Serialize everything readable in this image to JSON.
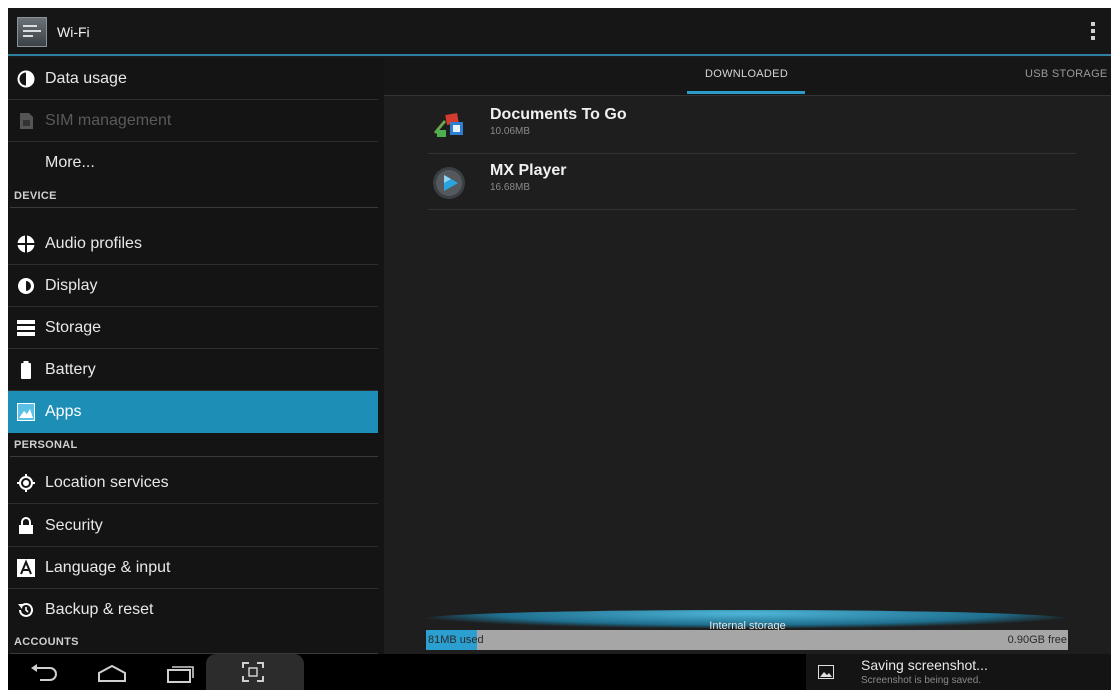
{
  "action_bar": {
    "title": "Wi-Fi",
    "app_icon": "settings-app-icon",
    "overflow_icon": "overflow-menu-icon"
  },
  "sidebar": {
    "rows": [
      {
        "label": "Data usage",
        "icon": "data-usage-icon",
        "state": "normal"
      },
      {
        "label": "SIM management",
        "icon": "sim-icon",
        "state": "disabled"
      },
      {
        "label": "More...",
        "icon": "",
        "state": "normal"
      }
    ],
    "device_header": "DEVICE",
    "device_rows": [
      {
        "label": "Audio profiles",
        "icon": "audio-profiles-icon"
      },
      {
        "label": "Display",
        "icon": "display-icon"
      },
      {
        "label": "Storage",
        "icon": "storage-icon"
      },
      {
        "label": "Battery",
        "icon": "battery-icon"
      },
      {
        "label": "Apps",
        "icon": "apps-icon",
        "selected": true
      }
    ],
    "personal_header": "PERSONAL",
    "personal_rows": [
      {
        "label": "Location services",
        "icon": "location-icon"
      },
      {
        "label": "Security",
        "icon": "lock-icon"
      },
      {
        "label": "Language & input",
        "icon": "keyboard-a-icon"
      },
      {
        "label": "Backup & reset",
        "icon": "backup-reset-icon"
      }
    ],
    "accounts_header": "ACCOUNTS"
  },
  "tabs": [
    {
      "label": "DOWNLOADED",
      "selected": true
    },
    {
      "label": "USB STORAGE",
      "selected": false
    }
  ],
  "apps": [
    {
      "name": "Documents To Go",
      "size": "10.06MB",
      "icon": "documents-to-go-icon"
    },
    {
      "name": "MX Player",
      "size": "16.68MB",
      "icon": "mx-player-icon"
    }
  ],
  "storage": {
    "label": "Internal storage",
    "used": "81MB used",
    "free": "0.90GB free",
    "used_fraction": 0.08
  },
  "nav": {
    "back": "back-icon",
    "home": "home-icon",
    "recents": "recent-apps-icon",
    "screenshot": "screenshot-icon"
  },
  "notification": {
    "title": "Saving screenshot...",
    "subtitle": "Screenshot is being saved."
  },
  "colors": {
    "accent": "#1d8fb7",
    "background": "#1a1a1a",
    "storage_used": "#2a9fd0"
  }
}
